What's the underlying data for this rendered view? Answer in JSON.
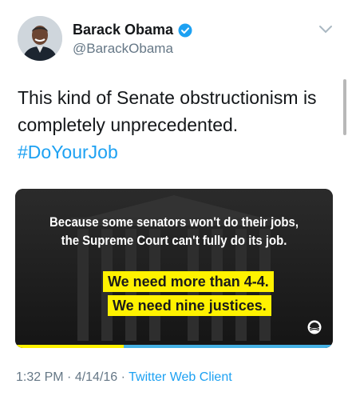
{
  "author": {
    "name": "Barack Obama",
    "handle": "@BarackObama",
    "verified": true
  },
  "tweet": {
    "text_line1": "This kind of Senate obstructionism is",
    "text_line2": "completely unprecedented.",
    "hashtag": "#DoYourJob"
  },
  "media": {
    "line1": "Because some senators won't do their jobs,",
    "line2": "the Supreme Court can't fully do its job.",
    "highlight1": "We need more than 4-4.",
    "highlight2": "We need nine justices.",
    "colors": {
      "highlight": "#fff200",
      "accent_blue": "#45b1e4"
    }
  },
  "meta": {
    "time": "1:32 PM",
    "separator1": " · ",
    "date": "4/14/16",
    "separator2": " · ",
    "client": "Twitter Web Client"
  },
  "icons": [
    "avatar",
    "verified-badge-icon",
    "chevron-down-icon",
    "obama-logo-icon"
  ],
  "colors": {
    "link": "#1da1f2",
    "muted": "#657786",
    "text": "#14171a"
  }
}
